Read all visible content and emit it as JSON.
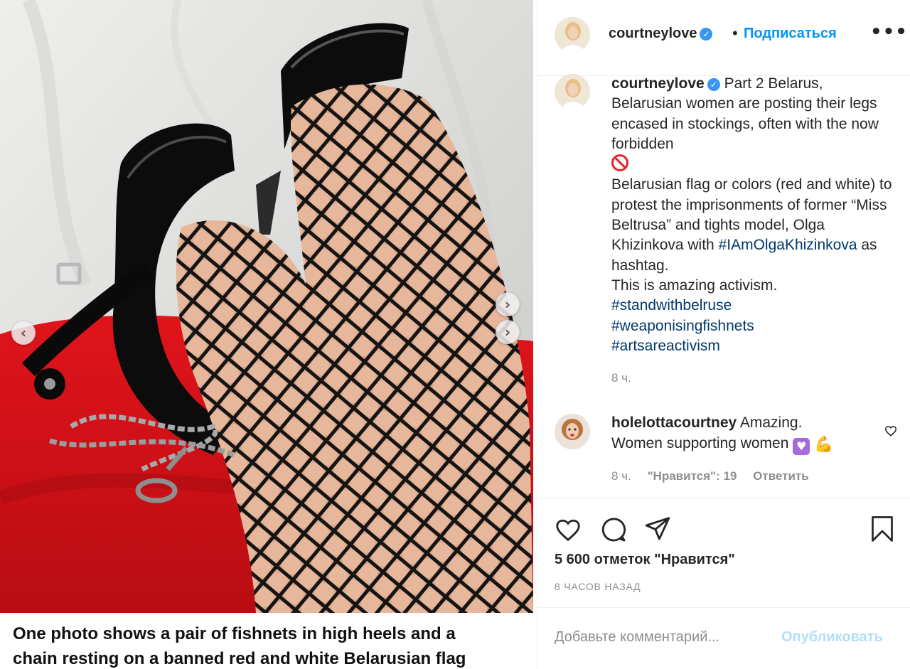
{
  "photo": {
    "caption_line_1": "One photo shows a pair of fishnets in high heels and a",
    "caption_line_2": "chain resting on a banned red and white Belarusian flag",
    "prev_icon": "chevron-left-icon",
    "next_icon": "chevron-right-icon"
  },
  "header": {
    "username": "courtneylove",
    "separator": "•",
    "follow_label": "Подписаться",
    "more_label": "•••"
  },
  "post": {
    "username": "courtneylove",
    "text_1": "Part 2 Belarus, Belarusian women are posting their legs encased in stockings, often with the now forbidden",
    "text_2": "Belarusian flag or colors (red and white) to protest the imprisonments of former “Miss Beltrusa” and tights model, Olga Khizinkova with",
    "hashtag_main": "#IAmOlgaKhizinkova",
    "text_3": "as hashtag.",
    "text_4": "This is amazing activism.",
    "hashtags": [
      "#standwithbelruse",
      "#weaponisingfishnets",
      "#artsareactivism"
    ],
    "time": "8 ч."
  },
  "comment": {
    "username": "holelottacourtney",
    "text_1": "Amazing.",
    "text_2": "Women supporting women",
    "time": "8 ч.",
    "likes": "\"Нравится\": 19",
    "reply": "Ответить"
  },
  "actions": {
    "likes_count": "5 600 отметок \"Нравится\"",
    "post_age": "8 ЧАСОВ НАЗАД"
  },
  "comment_box": {
    "placeholder": "Добавьте комментарий...",
    "publish_label": "Опубликовать"
  },
  "colors": {
    "accent": "#0095f6",
    "hashtag": "#00376b",
    "muted": "#8e8e8e",
    "flag_red": "#d8141a"
  }
}
